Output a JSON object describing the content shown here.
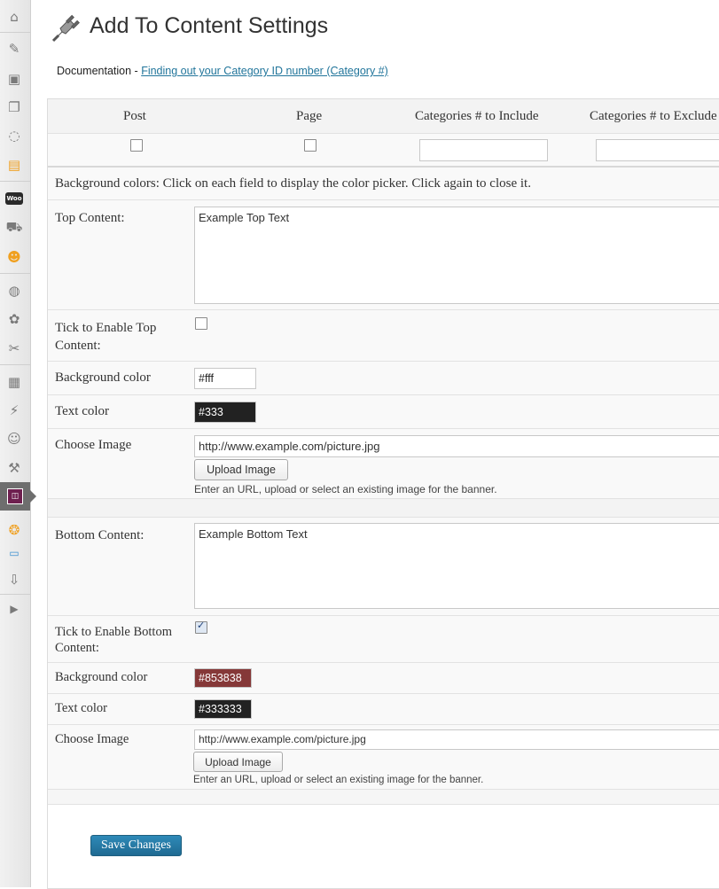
{
  "header": {
    "title": "Add To Content Settings",
    "doc_prefix": "Documentation - ",
    "doc_link": "Finding out your Category ID number (Category #)"
  },
  "sidebar": {
    "icons": [
      "home-icon",
      "pin-icon",
      "media-icon",
      "pages-icon",
      "comments-icon",
      "forms-icon",
      "woo-icon",
      "cart-icon",
      "user-icon",
      "globe-icon",
      "appearance-icon",
      "tools-icon",
      "widgets-icon",
      "plugins-icon",
      "users-icon",
      "settings-icon",
      "extension-icon",
      "orange-icon",
      "bubble-icon",
      "download-icon",
      "play-icon"
    ],
    "woo_label": "Woo"
  },
  "categories": {
    "headers": [
      "Post",
      "Page",
      "Categories # to Include",
      "Categories # to Exclude"
    ],
    "post_checked": false,
    "page_checked": false,
    "include_value": "",
    "exclude_value": ""
  },
  "instructions": "Background colors: Click on each field to display the color picker. Click again to close it.",
  "top": {
    "content_label": "Top Content:",
    "content_value": "Example Top Text",
    "enable_label": "Tick to Enable Top Content:",
    "enabled": false,
    "bg_label": "Background color",
    "bg_value": "#fff",
    "text_label": "Text color",
    "text_value": "#333",
    "image_label": "Choose Image",
    "image_value": "http://www.example.com/picture.jpg",
    "upload_label": "Upload Image",
    "hint": "Enter an URL, upload or select an existing image for the banner."
  },
  "bottom": {
    "content_label": "Bottom Content:",
    "content_value": "Example Bottom Text",
    "enable_label": "Tick to Enable Bottom Content:",
    "enabled": true,
    "bg_label": "Background color",
    "bg_value": "#853838",
    "text_label": "Text color",
    "text_value": "#333333",
    "image_label": "Choose Image",
    "image_value": "http://www.example.com/picture.jpg",
    "upload_label": "Upload Image",
    "hint": "Enter an URL, upload or select an existing image for the banner."
  },
  "save_label": "Save Changes",
  "colors": {
    "link": "#21759b",
    "primary_button": "#21759b",
    "bottom_bg_swatch": "#853838",
    "dark_swatch": "#222222"
  }
}
